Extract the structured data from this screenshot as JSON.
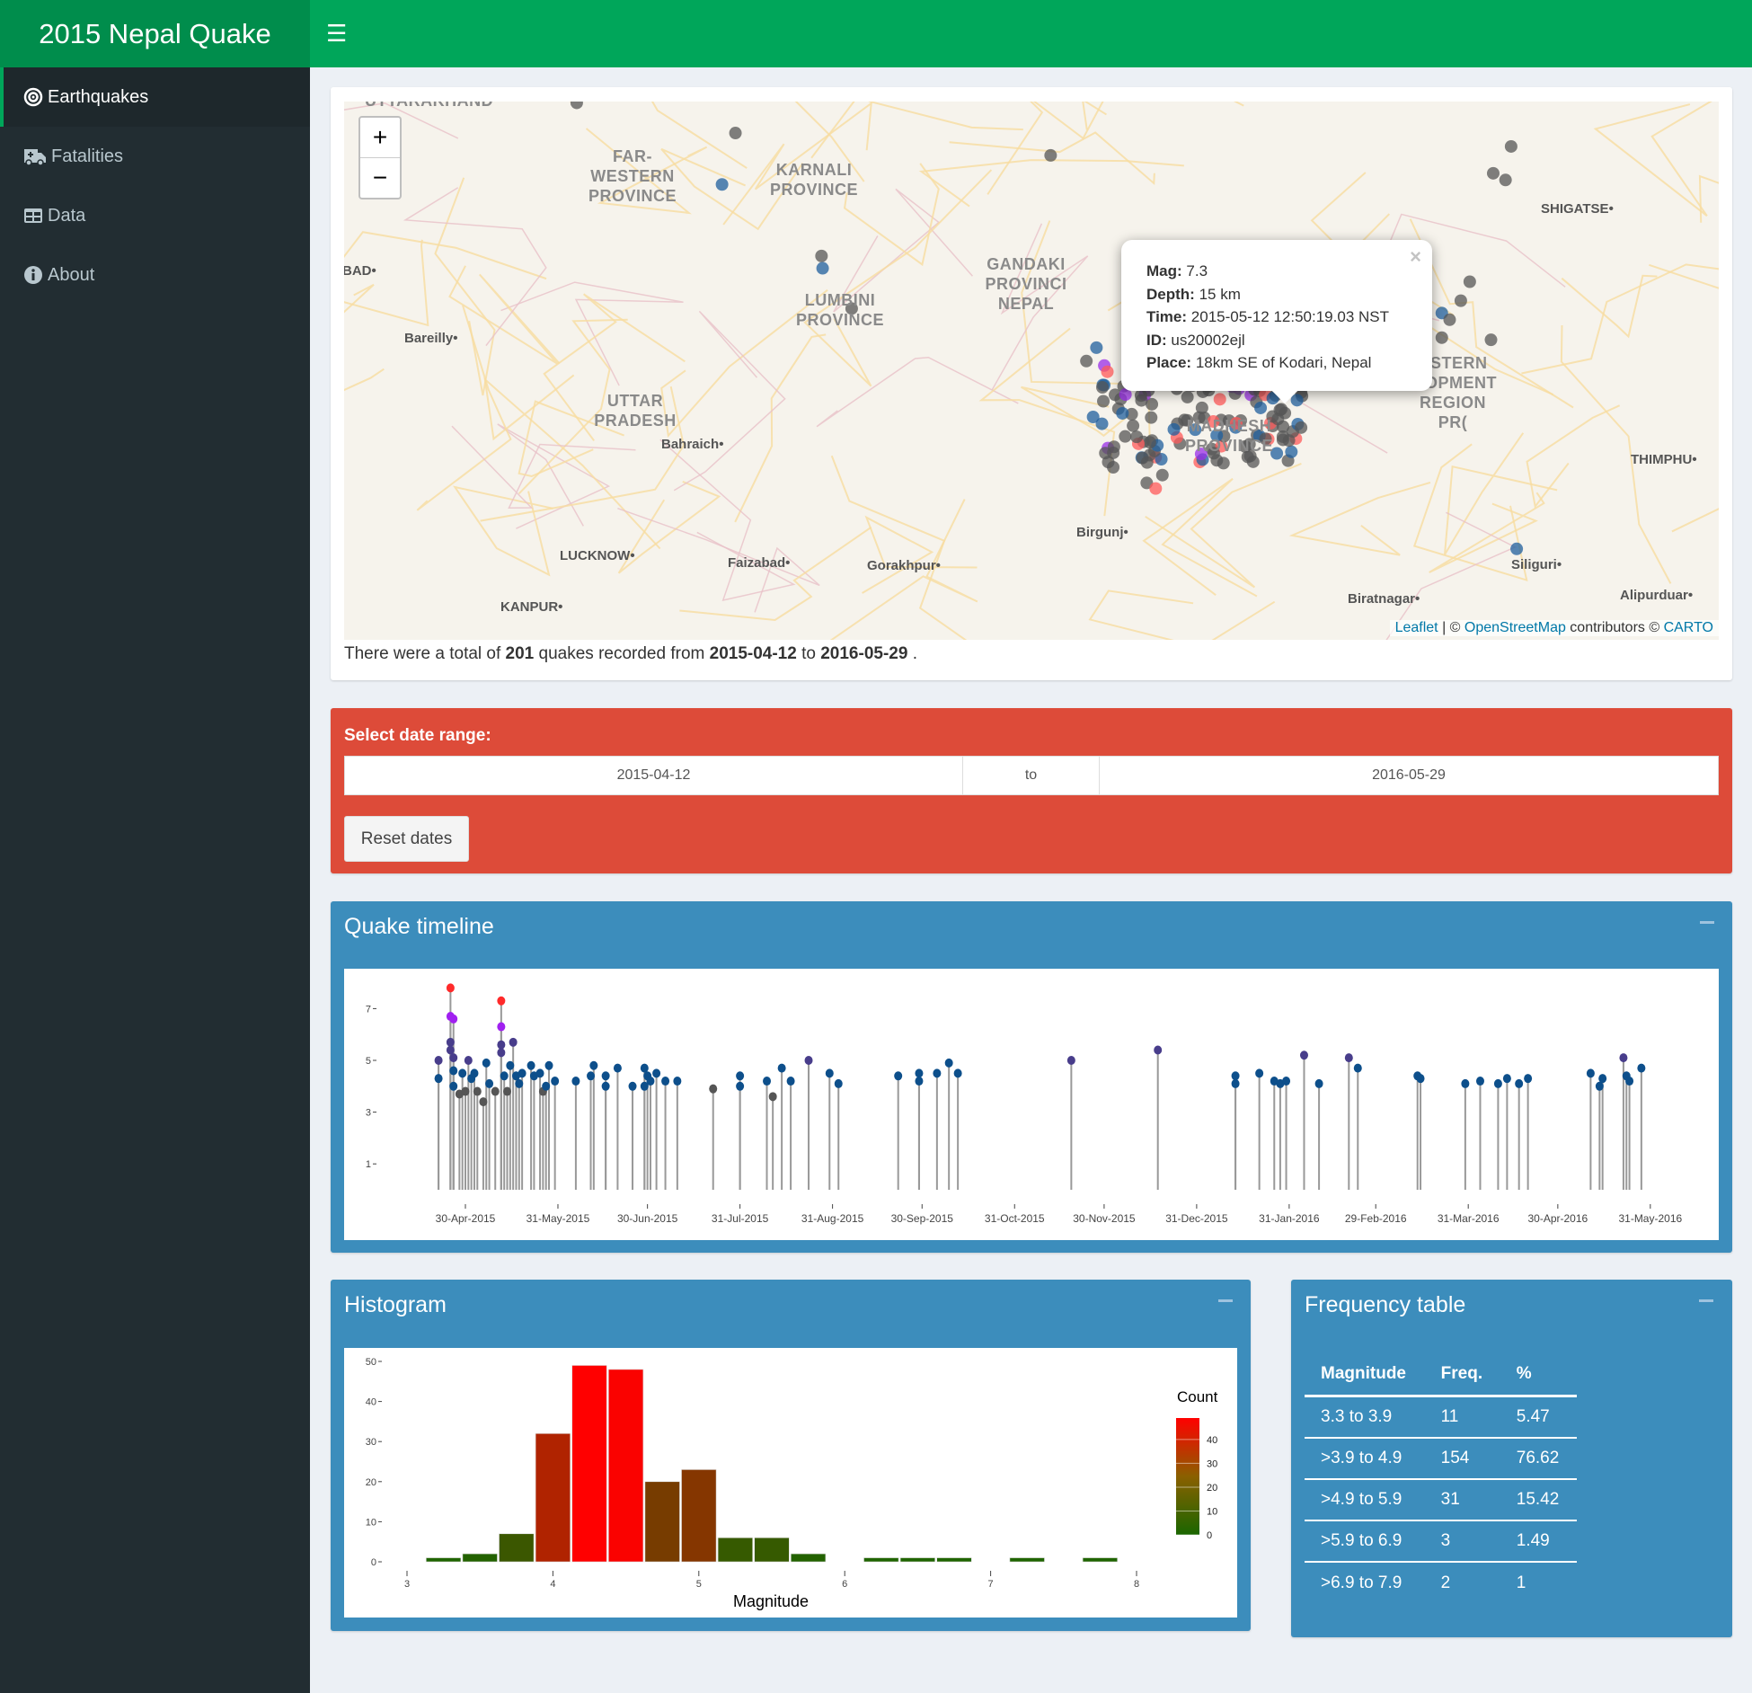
{
  "app": {
    "title": "2015 Nepal Quake",
    "menu_icon": "hamburger-icon",
    "header_color": "#00a65a"
  },
  "sidebar": {
    "items": [
      {
        "label": "Earthquakes",
        "icon": "bullseye-icon",
        "active": true
      },
      {
        "label": "Fatalities",
        "icon": "ambulance-icon"
      },
      {
        "label": "Data",
        "icon": "table-icon"
      },
      {
        "label": "About",
        "icon": "info-circle-icon"
      }
    ]
  },
  "map": {
    "zoom_in": "+",
    "zoom_out": "−",
    "regions": [
      "UTTARAKHAND",
      "FAR-\nWESTERN\nPROVINCE",
      "KARNALI\nPROVINCE",
      "LUMBINI\nPROVINCE",
      "GANDAKI\nPROVINCI\nNEPAL",
      "UTTAR\nPRADESH",
      "MADHESH\nPROVINCE",
      "ASTERN\n:LOPMENT\nREGION\nPR("
    ],
    "cities": [
      "SHIGATSE",
      "BAD",
      "Bareilly",
      "Bahraich",
      "LUCKNOW",
      "Faizabad",
      "Gorakhpur",
      "KANPUR",
      "Birgunj",
      "THIMPHU",
      "Siliguri",
      "Biratnagar",
      "Alipurduar"
    ],
    "popup": {
      "mag_label": "Mag:",
      "mag": "7.3",
      "depth_label": "Depth:",
      "depth": "15 km",
      "time_label": "Time:",
      "time": "2015-05-12 12:50:19.03 NST",
      "id_label": "ID:",
      "id": "us20002ejl",
      "place_label": "Place:",
      "place": "18km SE of Kodari, Nepal",
      "close": "×"
    },
    "attribution": {
      "leaflet": "Leaflet",
      "sep": " | © ",
      "osm": "OpenStreetMap",
      "contrib": " contributors © ",
      "carto": "CARTO"
    }
  },
  "summary": {
    "pre": "There were a total of ",
    "count": "201",
    "mid1": " quakes recorded from ",
    "from": "2015-04-12",
    "mid2": " to ",
    "to": "2016-05-29",
    "post": " ."
  },
  "date_range": {
    "label": "Select date range:",
    "start": "2015-04-12",
    "sep": "to",
    "end": "2016-05-29",
    "reset": "Reset dates",
    "color": "#dd4b39"
  },
  "timeline": {
    "title": "Quake timeline",
    "collapse": "−"
  },
  "histogram": {
    "title": "Histogram",
    "collapse": "−"
  },
  "freq_table": {
    "title": "Frequency table",
    "collapse": "−",
    "headers": [
      "Magnitude",
      "Freq.",
      "%"
    ],
    "rows": [
      [
        "3.3 to 3.9",
        "11",
        "5.47"
      ],
      [
        ">3.9 to 4.9",
        "154",
        "76.62"
      ],
      [
        ">4.9 to 5.9",
        "31",
        "15.42"
      ],
      [
        ">5.9 to 6.9",
        "3",
        "1.49"
      ],
      [
        ">6.9 to 7.9",
        "2",
        "1"
      ]
    ]
  },
  "chart_data": [
    {
      "type": "scatter",
      "subtype": "lollipop",
      "xlabel": "",
      "ylabel": "",
      "yticks": [
        1,
        3,
        5,
        7
      ],
      "xticks": [
        "30-Apr-2015",
        "31-May-2015",
        "30-Jun-2015",
        "31-Jul-2015",
        "31-Aug-2015",
        "30-Sep-2015",
        "31-Oct-2015",
        "30-Nov-2015",
        "31-Dec-2015",
        "31-Jan-2016",
        "29-Feb-2016",
        "31-Mar-2016",
        "30-Apr-2016",
        "31-May-2016"
      ],
      "xtick_dates": [
        "2015-04-30",
        "2015-05-31",
        "2015-06-30",
        "2015-07-31",
        "2015-08-31",
        "2015-09-30",
        "2015-10-31",
        "2015-11-30",
        "2015-12-31",
        "2016-01-31",
        "2016-02-29",
        "2016-03-31",
        "2016-04-30",
        "2016-05-31"
      ],
      "color_scale": {
        "<4": "#555555",
        "4-5": "#0d4f8b",
        "5-6": "#483d8b",
        "6-7": "#a020f0",
        ">=7": "#ff2a2a"
      },
      "points": [
        [
          "2015-04-21",
          5.0
        ],
        [
          "2015-04-21",
          4.3
        ],
        [
          "2015-04-25",
          7.8
        ],
        [
          "2015-04-25",
          6.7
        ],
        [
          "2015-04-26",
          6.6
        ],
        [
          "2015-04-25",
          5.7
        ],
        [
          "2015-04-25",
          5.4
        ],
        [
          "2015-04-26",
          5.1
        ],
        [
          "2015-04-26",
          4.6
        ],
        [
          "2015-04-26",
          4.0
        ],
        [
          "2015-04-28",
          3.7
        ],
        [
          "2015-04-29",
          4.5
        ],
        [
          "2015-04-30",
          3.8
        ],
        [
          "2015-05-01",
          5.0
        ],
        [
          "2015-05-02",
          4.3
        ],
        [
          "2015-05-03",
          4.5
        ],
        [
          "2015-05-04",
          3.8
        ],
        [
          "2015-05-06",
          3.4
        ],
        [
          "2015-05-07",
          4.9
        ],
        [
          "2015-05-08",
          4.1
        ],
        [
          "2015-05-10",
          3.8
        ],
        [
          "2015-05-12",
          7.3
        ],
        [
          "2015-05-12",
          6.3
        ],
        [
          "2015-05-12",
          5.6
        ],
        [
          "2015-05-12",
          5.3
        ],
        [
          "2015-05-13",
          4.4
        ],
        [
          "2015-05-14",
          3.8
        ],
        [
          "2015-05-15",
          4.8
        ],
        [
          "2015-05-16",
          5.7
        ],
        [
          "2015-05-17",
          4.4
        ],
        [
          "2015-05-18",
          4.1
        ],
        [
          "2015-05-19",
          4.5
        ],
        [
          "2015-05-22",
          4.8
        ],
        [
          "2015-05-23",
          4.4
        ],
        [
          "2015-05-25",
          4.5
        ],
        [
          "2015-05-26",
          3.8
        ],
        [
          "2015-05-27",
          4.0
        ],
        [
          "2015-05-28",
          4.8
        ],
        [
          "2015-05-30",
          4.2
        ],
        [
          "2015-06-06",
          4.2
        ],
        [
          "2015-06-11",
          4.4
        ],
        [
          "2015-06-12",
          4.8
        ],
        [
          "2015-06-16",
          4.4
        ],
        [
          "2015-06-16",
          4.0
        ],
        [
          "2015-06-20",
          4.7
        ],
        [
          "2015-06-25",
          4.0
        ],
        [
          "2015-06-29",
          4.7
        ],
        [
          "2015-06-29",
          4.0
        ],
        [
          "2015-06-30",
          4.4
        ],
        [
          "2015-07-01",
          4.2
        ],
        [
          "2015-07-03",
          4.5
        ],
        [
          "2015-07-06",
          4.2
        ],
        [
          "2015-07-10",
          4.2
        ],
        [
          "2015-07-22",
          3.9
        ],
        [
          "2015-07-31",
          4.4
        ],
        [
          "2015-07-31",
          4.0
        ],
        [
          "2015-08-09",
          4.2
        ],
        [
          "2015-08-11",
          3.6
        ],
        [
          "2015-08-14",
          4.7
        ],
        [
          "2015-08-17",
          4.2
        ],
        [
          "2015-08-23",
          5.0
        ],
        [
          "2015-08-30",
          4.5
        ],
        [
          "2015-09-02",
          4.1
        ],
        [
          "2015-09-22",
          4.4
        ],
        [
          "2015-09-29",
          4.5
        ],
        [
          "2015-09-29",
          4.2
        ],
        [
          "2015-10-05",
          4.5
        ],
        [
          "2015-10-09",
          4.9
        ],
        [
          "2015-10-12",
          4.5
        ],
        [
          "2015-11-19",
          5.0
        ],
        [
          "2015-12-18",
          5.4
        ],
        [
          "2016-01-13",
          4.4
        ],
        [
          "2016-01-13",
          4.1
        ],
        [
          "2016-01-21",
          4.5
        ],
        [
          "2016-01-26",
          4.2
        ],
        [
          "2016-01-28",
          4.1
        ],
        [
          "2016-01-30",
          4.2
        ],
        [
          "2016-02-05",
          5.2
        ],
        [
          "2016-02-10",
          4.1
        ],
        [
          "2016-02-20",
          5.1
        ],
        [
          "2016-02-23",
          4.7
        ],
        [
          "2016-03-14",
          4.4
        ],
        [
          "2016-03-15",
          4.3
        ],
        [
          "2016-03-30",
          4.1
        ],
        [
          "2016-04-04",
          4.2
        ],
        [
          "2016-04-10",
          4.1
        ],
        [
          "2016-04-13",
          4.3
        ],
        [
          "2016-04-17",
          4.1
        ],
        [
          "2016-04-20",
          4.3
        ],
        [
          "2016-05-11",
          4.5
        ],
        [
          "2016-05-14",
          4.0
        ],
        [
          "2016-05-15",
          4.3
        ],
        [
          "2016-05-22",
          5.1
        ],
        [
          "2016-05-23",
          4.4
        ],
        [
          "2016-05-24",
          4.2
        ],
        [
          "2016-05-28",
          4.7
        ]
      ]
    },
    {
      "type": "bar",
      "subtype": "histogram",
      "xlabel": "Magnitude",
      "ylabel": "",
      "xlim": [
        3,
        8
      ],
      "ylim": [
        0,
        50
      ],
      "xticks": [
        3,
        4,
        5,
        6,
        7,
        8
      ],
      "yticks": [
        0,
        10,
        20,
        30,
        40,
        50
      ],
      "bin_width": 0.25,
      "bin_centers": [
        3.25,
        3.5,
        3.75,
        4.0,
        4.25,
        4.5,
        4.75,
        5.0,
        5.25,
        5.5,
        5.75,
        6.0,
        6.25,
        6.5,
        6.75,
        7.0,
        7.25,
        7.5,
        7.75
      ],
      "values": [
        1,
        2,
        7,
        32,
        49,
        48,
        20,
        23,
        6,
        6,
        2,
        0,
        1,
        1,
        1,
        0,
        1,
        0,
        1
      ],
      "legend": {
        "title": "Count",
        "ticks": [
          0,
          10,
          20,
          30,
          40
        ],
        "low_color": "#1a6600",
        "high_color": "#ff0000",
        "placement": "right"
      }
    }
  ]
}
